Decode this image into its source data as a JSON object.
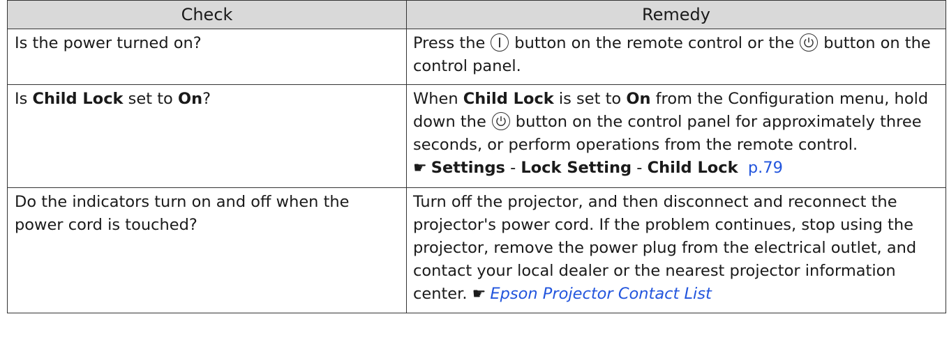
{
  "headers": {
    "check": "Check",
    "remedy": "Remedy"
  },
  "rows": [
    {
      "check": "Is the power turned on?",
      "remedy": {
        "t1": "Press the",
        "t2": "button on the remote control or the",
        "t3": "button on the control panel."
      }
    },
    {
      "check": {
        "pre": "Is ",
        "bold1": "Child Lock",
        "mid": " set to ",
        "bold2": "On",
        "post": "?"
      },
      "remedy": {
        "t1": "When ",
        "b1": "Child Lock",
        "t2": " is set to ",
        "b2": "On",
        "t3": " from the Configuration menu, hold down the",
        "t4": "button on the control panel for approximately three seconds, or perform operations from the remote control.",
        "ref_b1": "Settings",
        "sep1": " - ",
        "ref_b2": "Lock Setting",
        "sep2": " - ",
        "ref_b3": "Child Lock",
        "ref_page": "p.79"
      }
    },
    {
      "check": "Do the indicators turn on and off when the power cord is touched?",
      "remedy": {
        "text": "Turn off the projector, and then disconnect and reconnect the projector's power cord. If the problem continues, stop using the projector, remove the power plug from the electrical outlet, and contact your local dealer or the nearest projector information center.",
        "link": "Epson Projector Contact List"
      }
    }
  ],
  "icons": {
    "on_button": "power-on-icon",
    "standby_button": "standby-icon",
    "reference": "pointing-hand-icon"
  },
  "colors": {
    "header_bg": "#d9d9d9",
    "link": "#2255dd"
  }
}
